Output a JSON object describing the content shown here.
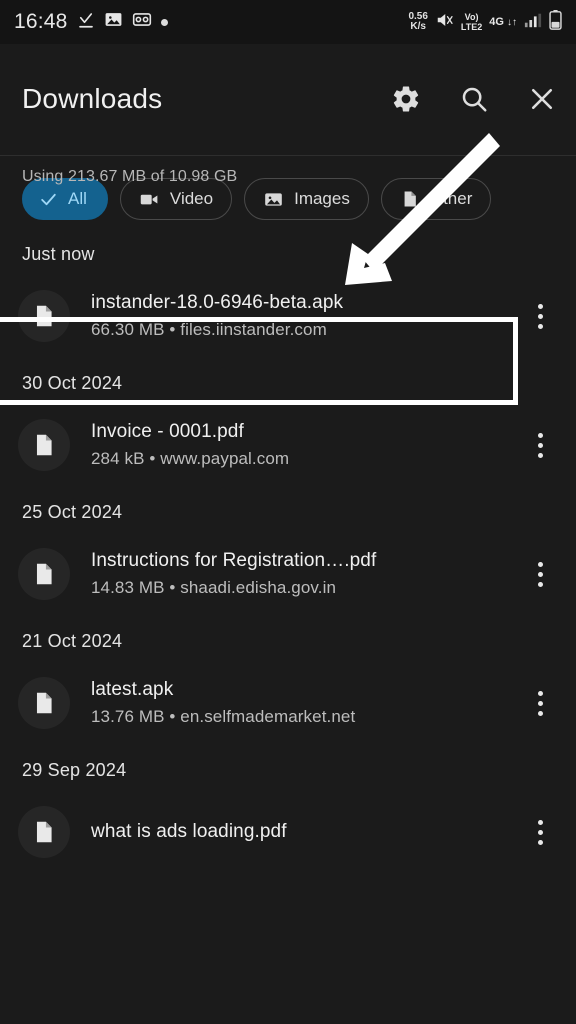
{
  "status_bar": {
    "clock": "16:48",
    "left_icons": [
      "download-complete-icon",
      "gallery-icon",
      "voicemail-icon",
      "dot-icon"
    ],
    "net_speed_value": "0.56",
    "net_speed_unit": "K/s",
    "mute_icon": "mute-icon",
    "volte_top": "Vo)",
    "volte_bottom": "LTE2",
    "network_type": "4G",
    "data_arrows": "↓↑",
    "signal_icon": "signal-bars-icon",
    "battery_icon": "battery-icon"
  },
  "header": {
    "title": "Downloads",
    "settings_icon": "gear-icon",
    "search_icon": "search-icon",
    "close_icon": "close-icon",
    "storage_text": "Using 213.67 MB of 10.98 GB"
  },
  "filters": [
    {
      "label": "All",
      "icon": "check-icon",
      "selected": true
    },
    {
      "label": "Video",
      "icon": "video-camera-icon",
      "selected": false
    },
    {
      "label": "Images",
      "icon": "image-icon",
      "selected": false
    },
    {
      "label": "Other",
      "icon": "document-icon",
      "selected": false
    }
  ],
  "groups": [
    {
      "date": "Just now",
      "files": [
        {
          "name": "instander-18.0-6946-beta.apk",
          "meta": "66.30 MB • files.iinstander.com",
          "highlighted": true
        }
      ]
    },
    {
      "date": "30 Oct 2024",
      "files": [
        {
          "name": "Invoice - 0001.pdf",
          "meta": "284 kB • www.paypal.com",
          "highlighted": false
        }
      ]
    },
    {
      "date": "25 Oct 2024",
      "files": [
        {
          "name": "Instructions for Registration….pdf",
          "meta": "14.83 MB • shaadi.edisha.gov.in",
          "highlighted": false
        }
      ]
    },
    {
      "date": "21 Oct 2024",
      "files": [
        {
          "name": "latest.apk",
          "meta": "13.76 MB • en.selfmademarket.net",
          "highlighted": false
        }
      ]
    },
    {
      "date": "29 Sep 2024",
      "files": [
        {
          "name": "what is ads loading.pdf",
          "meta": "",
          "highlighted": false
        }
      ]
    }
  ],
  "annotations": {
    "arrow": "white-arrow-annotation",
    "highlight_box": "white-highlight-box"
  },
  "colors": {
    "background": "#1b1b1b",
    "status_bar_bg": "#141414",
    "chip_selected_bg": "#14628f",
    "chip_selected_text": "#9fd8f7",
    "annotation": "#ffffff"
  }
}
